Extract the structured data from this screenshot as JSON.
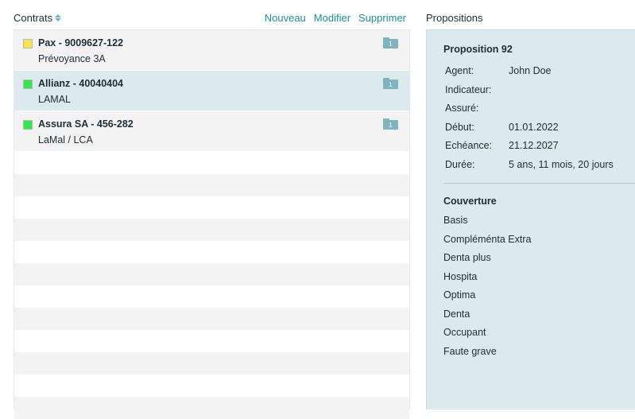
{
  "contracts_panel": {
    "title": "Contrats",
    "actions": {
      "new": "Nouveau",
      "edit": "Modifier",
      "delete": "Supprimer"
    },
    "items": [
      {
        "name": "Pax - 9009627-122",
        "sub": "Prévoyance 3A",
        "color": "#f7e34a",
        "count": "1",
        "selected": false
      },
      {
        "name": "Allianz - 40040404",
        "sub": "LAMAL",
        "color": "#2fe84a",
        "count": "1",
        "selected": true
      },
      {
        "name": "Assura SA - 456-282",
        "sub": "LaMal / LCA",
        "color": "#2fe84a",
        "count": "1",
        "selected": false
      }
    ]
  },
  "propositions_panel": {
    "title": "Propositions",
    "proposal_title": "Proposition 92",
    "fields": [
      {
        "label": "Agent:",
        "value": "John Doe"
      },
      {
        "label": "Indicateur:",
        "value": ""
      },
      {
        "label": "Assuré:",
        "value": ""
      },
      {
        "label": "Début:",
        "value": "01.01.2022"
      },
      {
        "label": "Echéance:",
        "value": "21.12.2027"
      },
      {
        "label": "Durée:",
        "value": "5 ans, 11 mois, 20 jours"
      }
    ],
    "coverage_title": "Couverture",
    "coverage": [
      "Basis",
      "Compléménta Extra",
      "Denta plus",
      "Hospita",
      "Optima",
      "Denta",
      "Occupant",
      "Faute grave"
    ]
  },
  "colors": {
    "accent": "#1a8f94",
    "selected_row": "#dce9ee",
    "row_bg": "#f3f3f3",
    "folder": "#7fb3bd"
  },
  "icons": {
    "sort": "sort-icon",
    "folder": "folder-icon"
  }
}
